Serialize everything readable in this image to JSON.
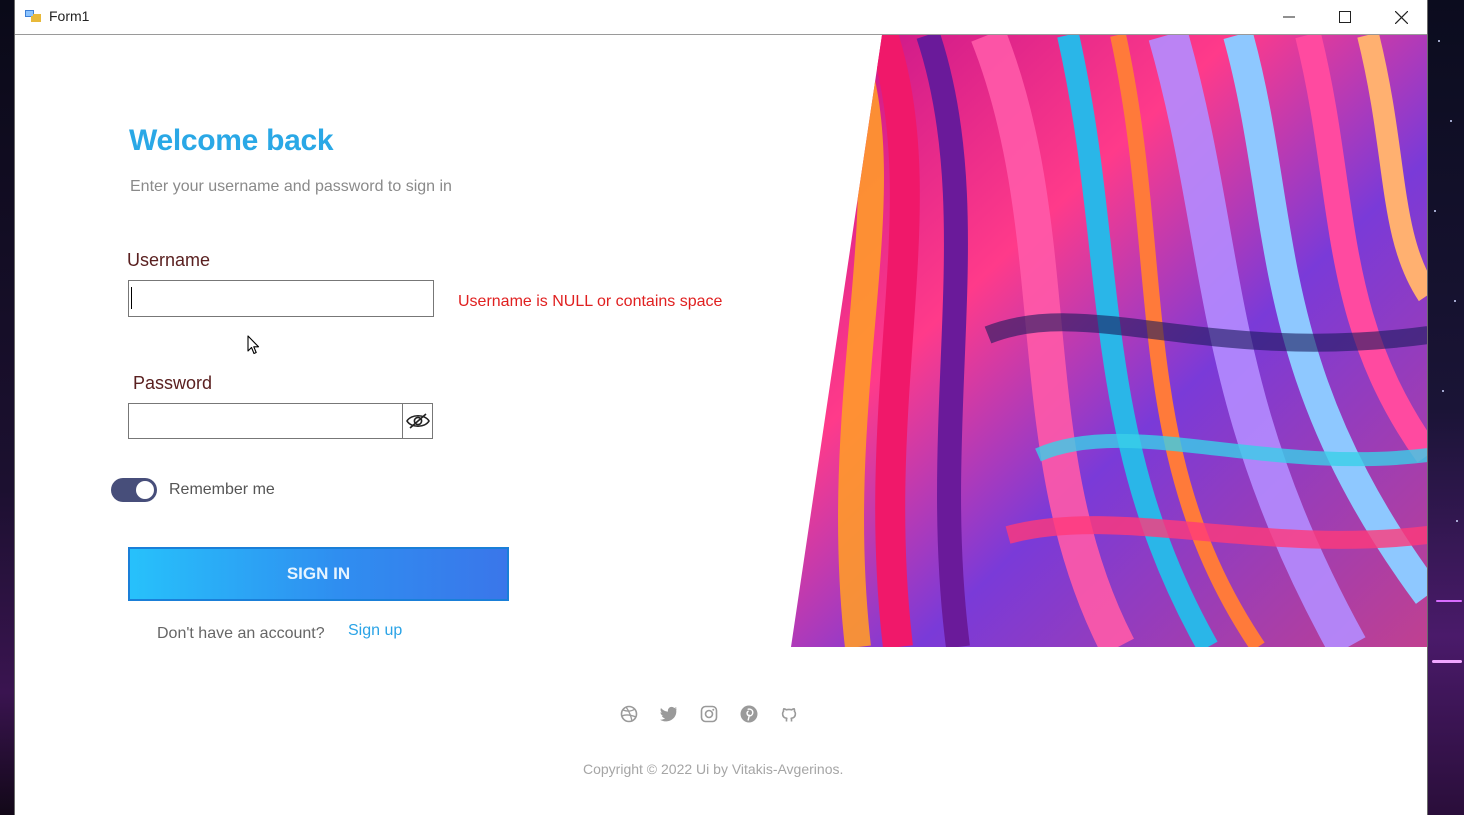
{
  "window": {
    "title": "Form1",
    "controls": [
      "minimize-icon",
      "maximize-icon",
      "close-icon"
    ]
  },
  "login": {
    "heading": "Welcome back",
    "subheading": "Enter your username and password to sign in",
    "username_label": "Username",
    "username_value": "",
    "username_error": "Username is NULL or contains space",
    "password_label": "Password",
    "password_value": "",
    "password_toggle_icon": "eye-hidden-icon",
    "remember_label": "Remember me",
    "remember_on": true,
    "signin_label": "SIGN IN",
    "no_account_text": "Don't have an account?",
    "signup_label": "Sign up"
  },
  "footer": {
    "socials": [
      "dribbble-icon",
      "twitter-icon",
      "instagram-icon",
      "pinterest-icon",
      "github-icon"
    ],
    "copyright": "Copyright © 2022 Ui by Vitakis-Avgerinos."
  },
  "colors": {
    "accent": "#2aa8e6",
    "error": "#e02020",
    "toggle": "#474e7a",
    "button_start": "#27c1fb",
    "button_end": "#3a76ea"
  }
}
